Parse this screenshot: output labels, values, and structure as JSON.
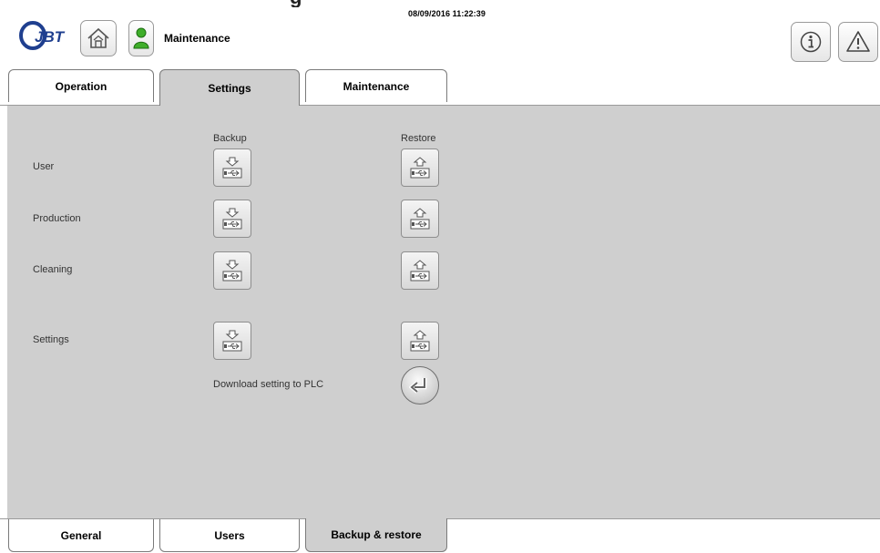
{
  "header": {
    "partial_title": "g",
    "user_role": "Maintenance",
    "datetime": "08/09/2016 11:22:39",
    "logo_text": "JBT",
    "icons": {
      "home": "home-icon",
      "user": "user-icon",
      "info": "info-icon",
      "alarm": "alarm-icon"
    }
  },
  "top_tabs": [
    {
      "label": "Operation",
      "active": false
    },
    {
      "label": "Settings",
      "active": true
    },
    {
      "label": "Maintenance",
      "active": false
    }
  ],
  "backup_restore": {
    "backup_header": "Backup",
    "restore_header": "Restore",
    "rows": [
      {
        "label": "User"
      },
      {
        "label": "Production"
      },
      {
        "label": "Cleaning"
      },
      {
        "label": "Settings"
      }
    ],
    "download_label": "Download setting to PLC"
  },
  "bottom_tabs": [
    {
      "label": "General",
      "active": false
    },
    {
      "label": "Users",
      "active": false
    },
    {
      "label": "Backup & restore",
      "active": true
    }
  ],
  "colors": {
    "panel": "#cfcfcf",
    "user_icon_green": "#3fae2a",
    "logo_blue": "#1f3f8f"
  }
}
